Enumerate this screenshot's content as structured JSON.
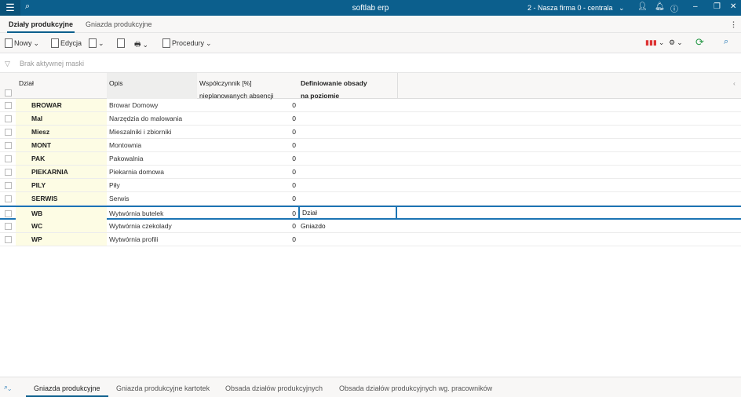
{
  "titlebar": {
    "title": "softlab erp",
    "firm": "2 - Nasza firma 0 - centrala"
  },
  "tabs": [
    {
      "label": "Działy produkcyjne",
      "active": true
    },
    {
      "label": "Gniazda produkcyjne",
      "active": false
    }
  ],
  "toolbar": {
    "new": "Nowy",
    "edit": "Edycja",
    "procedures": "Procedury"
  },
  "filter": {
    "text": "Brak aktywnej maski"
  },
  "columns": {
    "dzial": "Dział",
    "opis": "Opis",
    "wsp1": "Współczynnik [%]",
    "wsp2": "nieplanowanych absencji",
    "def1": "Definiowanie obsady",
    "def2": "na poziomie"
  },
  "rows": [
    {
      "dzial": "BROWAR",
      "opis": "Browar Domowy",
      "wsp": "0",
      "def": ""
    },
    {
      "dzial": "Mal",
      "opis": "Narzędzia do malowania",
      "wsp": "0",
      "def": ""
    },
    {
      "dzial": "Miesz",
      "opis": "Mieszalniki i zbiorniki",
      "wsp": "0",
      "def": ""
    },
    {
      "dzial": "MONT",
      "opis": "Montownia",
      "wsp": "0",
      "def": ""
    },
    {
      "dzial": "PAK",
      "opis": "Pakowalnia",
      "wsp": "0",
      "def": ""
    },
    {
      "dzial": "PIEKARNIA",
      "opis": "Piekarnia domowa",
      "wsp": "0",
      "def": ""
    },
    {
      "dzial": "PILY",
      "opis": "Piły",
      "wsp": "0",
      "def": ""
    },
    {
      "dzial": "SERWIS",
      "opis": "Serwis",
      "wsp": "0",
      "def": ""
    },
    {
      "dzial": "WB",
      "opis": "Wytwórnia butelek",
      "wsp": "0",
      "def": "Dział"
    },
    {
      "dzial": "WC",
      "opis": "Wytwórnia czekolady",
      "wsp": "0",
      "def": "Gniazdo"
    },
    {
      "dzial": "WP",
      "opis": "Wytwórnia profili",
      "wsp": "0",
      "def": ""
    }
  ],
  "bottom_tabs": [
    {
      "label": "Gniazda produkcyjne",
      "active": true
    },
    {
      "label": "Gniazda produkcyjne kartotek"
    },
    {
      "label": "Obsada działów produkcyjnych"
    },
    {
      "label": "Obsada działów produkcyjnych wg. pracowników"
    }
  ],
  "colors": {
    "titlebar": "#0c5f8d",
    "selection": "#1c74b4",
    "key_column": "#fdfce4"
  }
}
